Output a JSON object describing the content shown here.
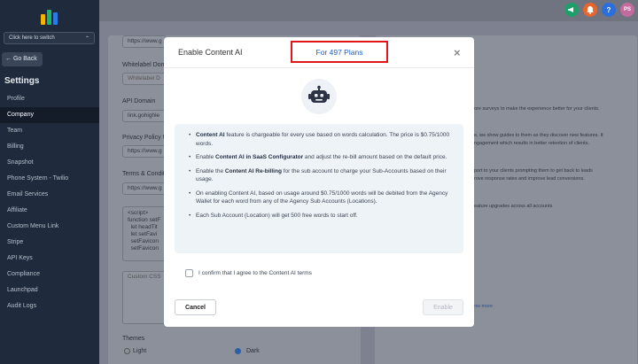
{
  "sidebar": {
    "switch_label": "Click here to switch",
    "go_back": "← Go Back",
    "settings_title": "Settings",
    "items": [
      {
        "label": "Profile"
      },
      {
        "label": "Company"
      },
      {
        "label": "Team"
      },
      {
        "label": "Billing"
      },
      {
        "label": "Snapshot"
      },
      {
        "label": "Phone System - Twilio"
      },
      {
        "label": "Email Services"
      },
      {
        "label": "Affiliate"
      },
      {
        "label": "Custom Menu Link"
      },
      {
        "label": "Stripe"
      },
      {
        "label": "API Keys"
      },
      {
        "label": "Compliance"
      },
      {
        "label": "Launchpad"
      },
      {
        "label": "Audit Logs"
      }
    ],
    "active_item": "Company"
  },
  "topbar": {
    "help_label": "?",
    "avatar_initials": "PS"
  },
  "background": {
    "url_value_1": "https://www.g",
    "whitelabel_label": "Whitelabel Dom",
    "whitelabel_placeholder": "Whitelabel D",
    "api_domain_label": "API Domain",
    "api_domain_value": "link.gohighle",
    "privacy_label": "Privacy Policy U",
    "privacy_value": "https://www.g",
    "terms_label": "Terms & Conditi",
    "terms_value": "https://www.g",
    "script_text": "<script>\nfunction setF\n  let headTit\n  let setFavi\n  setFavicon\n  setFavicon",
    "custom_css_placeholder": "Custom CSS",
    "themes_label": "Themes",
    "theme_light": "Light",
    "theme_dark": "Dark",
    "right_text_1": "ore surveys to make the experience better for your clients.",
    "right_text_2a": "e, we show guides to them as they discover new features. It",
    "right_text_2b": "ngagement which results in better retention of clients.",
    "right_text_3a": "port to your clients prompting them to get back to leads",
    "right_text_3b": "rove response rates and improve lead conversions.",
    "right_text_4": "eature upgrades across all accounts",
    "right_text_5": "ow more"
  },
  "modal": {
    "title": "Enable Content AI",
    "plans_text": "For 497 Plans",
    "close_label": "×",
    "bullets": [
      {
        "lead": "",
        "bold": "Content AI",
        "rest": " feature is chargeable for every use based on words calculation. The price is $0.75/1000 words."
      },
      {
        "lead": "Enable ",
        "bold": "Content AI in SaaS Configurator",
        "rest": " and adjust the re-bill amount based on the default price."
      },
      {
        "lead": "Enable the ",
        "bold": "Content AI Re-billing",
        "rest": " for the sub account to charge your Sub-Accounts based on their usage."
      },
      {
        "lead": "On enabling Content AI, based on usage around $0.75/1000 words will be debited from the Agency Wallet for each word from any of the Agency Sub Accounts (Locations).",
        "bold": "",
        "rest": ""
      },
      {
        "lead": "Each Sub Account (Location) will get 500 free words to start off.",
        "bold": "",
        "rest": ""
      }
    ],
    "consent_label": "I confirm that I agree to the Content AI terms",
    "cancel_label": "Cancel",
    "enable_label": "Enable"
  },
  "colors": {
    "sidebar_bg": "#1f2a3c",
    "highlight_border": "#e0161b",
    "plans_text": "#1c5fc4"
  },
  "icons": {
    "logo": "highlevel-logo",
    "bot": "robot-icon",
    "megaphone": "megaphone-icon",
    "bell": "bell-icon",
    "help": "help-icon",
    "close": "close-icon"
  }
}
